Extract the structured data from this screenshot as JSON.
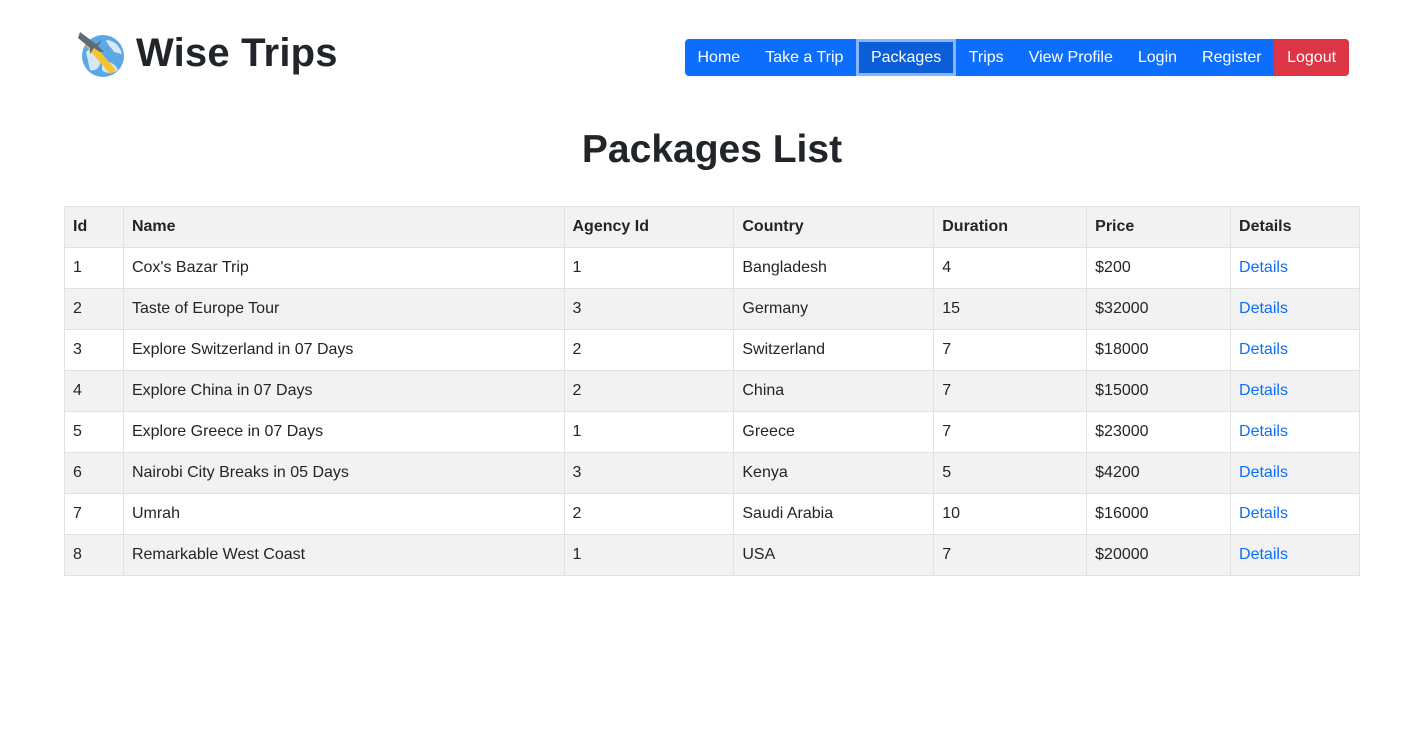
{
  "brand": {
    "title": "Wise Trips",
    "logo_icon": "globe-airplane-icon"
  },
  "nav": {
    "items": [
      {
        "label": "Home"
      },
      {
        "label": "Take a Trip"
      },
      {
        "label": "Packages",
        "active": true
      },
      {
        "label": "Trips"
      },
      {
        "label": "View Profile"
      },
      {
        "label": "Login"
      },
      {
        "label": "Register"
      },
      {
        "label": "Logout"
      }
    ],
    "colors": {
      "primary": "#0d6efd",
      "active": "#0b5ed7",
      "logout": "#dc3545"
    }
  },
  "page_title": "Packages List",
  "table": {
    "columns": [
      "Id",
      "Name",
      "Agency Id",
      "Country",
      "Duration",
      "Price",
      "Details"
    ],
    "rows": [
      [
        "1",
        "Cox's Bazar Trip",
        "1",
        "Bangladesh",
        "4",
        "$200",
        "Details"
      ],
      [
        "2",
        "Taste of Europe Tour",
        "3",
        "Germany",
        "15",
        "$32000",
        "Details"
      ],
      [
        "3",
        "Explore Switzerland in 07 Days",
        "2",
        "Switzerland",
        "7",
        "$18000",
        "Details"
      ],
      [
        "4",
        "Explore China in 07 Days",
        "2",
        "China",
        "7",
        "$15000",
        "Details"
      ],
      [
        "5",
        "Explore Greece in 07 Days",
        "1",
        "Greece",
        "7",
        "$23000",
        "Details"
      ],
      [
        "6",
        "Nairobi City Breaks in 05 Days",
        "3",
        "Kenya",
        "5",
        "$4200",
        "Details"
      ],
      [
        "7",
        "Umrah",
        "2",
        "Saudi Arabia",
        "10",
        "$16000",
        "Details"
      ],
      [
        "8",
        "Remarkable West Coast",
        "1",
        "USA",
        "7",
        "$20000",
        "Details"
      ]
    ]
  }
}
